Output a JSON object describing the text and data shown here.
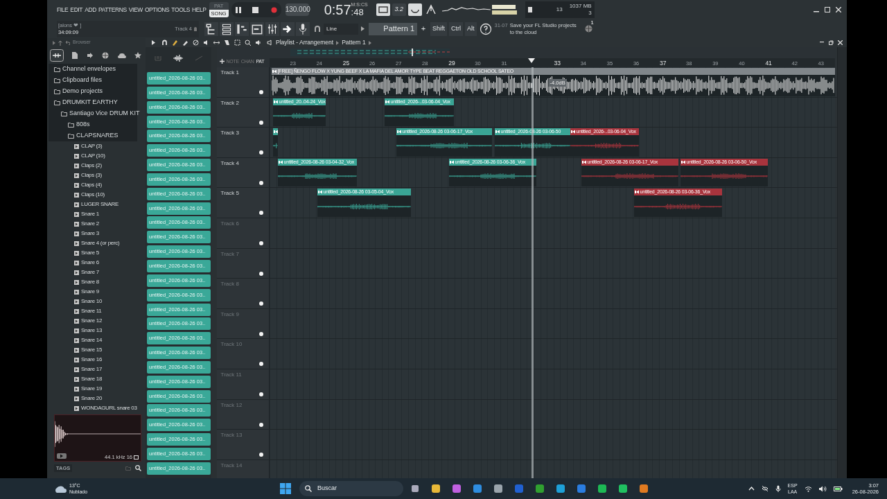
{
  "menu": [
    "FILE",
    "EDIT",
    "ADD",
    "PATTERNS",
    "VIEW",
    "OPTIONS",
    "TOOLS",
    "HELP"
  ],
  "transport": {
    "modes": [
      {
        "label": "PAT",
        "selected": false
      },
      {
        "label": "SONG",
        "selected": true
      }
    ],
    "tempo": "130.000",
    "time": "0:57",
    "time_cs": ":48",
    "time_format": "M:S:CS",
    "snap_value": "3.2"
  },
  "monitor": {
    "cpu": "13",
    "memory": "1037 MB",
    "polyphony": "3"
  },
  "hint": {
    "text": "[alons ❤ ]",
    "time": "34:09:09",
    "target": "Track 4"
  },
  "toolbar": {
    "snap": "Line",
    "pattern": "Pattern 1",
    "add": "+",
    "modifiers": [
      "Shift",
      "Ctrl",
      "Alt"
    ]
  },
  "news": {
    "date": "31-07",
    "text": "Save your FL Studio projects to the cloud",
    "badge": "1"
  },
  "browser": {
    "title": "Browser",
    "tree": [
      {
        "label": "Channel envelopes",
        "kind": "folder"
      },
      {
        "label": "Clipboard files",
        "kind": "folder"
      },
      {
        "label": "Demo projects",
        "kind": "folder"
      },
      {
        "label": "DRUMKIT EARTHY",
        "kind": "folder",
        "children": [
          {
            "label": "Santiago Vice DRUM KIT",
            "kind": "folder",
            "children": [
              {
                "label": "808s",
                "kind": "folder"
              },
              {
                "label": "CLAPSNARES",
                "kind": "folder",
                "children": [
                  {
                    "label": "CLAP (3)",
                    "kind": "sample"
                  },
                  {
                    "label": "CLAP (10)",
                    "kind": "sample"
                  },
                  {
                    "label": "Claps (2)",
                    "kind": "sample"
                  },
                  {
                    "label": "Claps (3)",
                    "kind": "sample"
                  },
                  {
                    "label": "Claps (4)",
                    "kind": "sample"
                  },
                  {
                    "label": "Claps (10)",
                    "kind": "sample"
                  },
                  {
                    "label": "LUGER SNARE",
                    "kind": "sample"
                  },
                  {
                    "label": "Snare 1",
                    "kind": "sample"
                  },
                  {
                    "label": "Snare 2",
                    "kind": "sample"
                  },
                  {
                    "label": "Snare 3",
                    "kind": "sample"
                  },
                  {
                    "label": "Snare 4 (or perc)",
                    "kind": "sample"
                  },
                  {
                    "label": "Snare 5",
                    "kind": "sample"
                  },
                  {
                    "label": "Snare 6",
                    "kind": "sample"
                  },
                  {
                    "label": "Snare 7",
                    "kind": "sample"
                  },
                  {
                    "label": "Snare 8",
                    "kind": "sample"
                  },
                  {
                    "label": "Snare 9",
                    "kind": "sample"
                  },
                  {
                    "label": "Snare 10",
                    "kind": "sample"
                  },
                  {
                    "label": "Snare 11",
                    "kind": "sample"
                  },
                  {
                    "label": "Snare 12",
                    "kind": "sample"
                  },
                  {
                    "label": "Snare 13",
                    "kind": "sample"
                  },
                  {
                    "label": "Snare 14",
                    "kind": "sample"
                  },
                  {
                    "label": "Snare 15",
                    "kind": "sample"
                  },
                  {
                    "label": "Snare 16",
                    "kind": "sample"
                  },
                  {
                    "label": "Snare 17",
                    "kind": "sample"
                  },
                  {
                    "label": "Snare 18",
                    "kind": "sample"
                  },
                  {
                    "label": "Snare 19",
                    "kind": "sample"
                  },
                  {
                    "label": "Snare 20",
                    "kind": "sample"
                  },
                  {
                    "label": "WONDAGURL snare 03",
                    "kind": "sample"
                  }
                ]
              }
            ]
          }
        ]
      }
    ],
    "preview": {
      "format": "44.1 kHz 16"
    },
    "tags": "TAGS"
  },
  "clip_list": [
    "untitled_2026-08-26 03..",
    "untitled_2026-08-26 03..",
    "untitled_2026-08-26 03..",
    "untitled_2026-08-26 03..",
    "untitled_2026-08-26 03..",
    "untitled_2026-08-26 03..",
    "untitled_2026-08-26 03..",
    "untitled_2026-08-26 03..",
    "untitled_2026-08-26 03..",
    "untitled_2026-08-26 03..",
    "untitled_2026-08-26 03..",
    "untitled_2026-08-26 03..",
    "untitled_2026-08-26 03..",
    "untitled_2026-08-26 03..",
    "untitled_2026-08-26 03..",
    "untitled_2026-08-26 03..",
    "untitled_2026-08-26 03..",
    "untitled_2026-08-26 03..",
    "untitled_2026-08-26 03..",
    "untitled_2026-08-26 03..",
    "untitled_2026-08-26 03..",
    "untitled_2026-08-26 03..",
    "untitled_2026-08-26 03..",
    "untitled_2026-08-26 03..",
    "untitled_2026-08-26 03..",
    "untitled_2026-08-26 03..",
    "untitled_2026-08-26 03..",
    "untitled_2026-08-26 03.."
  ],
  "playlist": {
    "title": "Playlist - Arrangement",
    "pattern": "Pattern 1",
    "modes": [
      "NOTE",
      "CHAN",
      "PAT"
    ],
    "ruler": [
      "23",
      "24",
      "25",
      "26",
      "27",
      "28",
      "29",
      "30",
      "31",
      "33",
      "34",
      "35",
      "36",
      "37",
      "38",
      "39",
      "40",
      "41",
      "42",
      "43"
    ],
    "tracks": [
      {
        "name": "Track 1",
        "clips": [
          {
            "label": "[FREE] ÑENGO FLOW X YUNG BEEF X LA MAFIA DEL AMOR TYPE BEAT REGGAETON OLD SCHOOL SATEO",
            "color": "#80868a",
            "gain": "-4.0dB"
          }
        ]
      },
      {
        "name": "Track 2",
        "clips": [
          {
            "label": "untitled_20..04-24_Vox",
            "color": "#3aa595"
          },
          {
            "label": "untitled_2026-..03-06-04_Vox",
            "color": "#3aa595"
          }
        ]
      },
      {
        "name": "Track 3",
        "clips": [
          {
            "color": "#3aa595"
          },
          {
            "label": "untitled_2026-08-26 03-06-17_Vox",
            "color": "#3aa595"
          },
          {
            "label": "untitled_2026-08-26 03-06-50",
            "color": "#3aa595"
          },
          {
            "label": "untitled_2026-..03-06-04_Vox",
            "color": "#a8343d"
          }
        ]
      },
      {
        "name": "Track 4",
        "clips": [
          {
            "label": "untitled_2026-08-26 03-04-32_Vox",
            "color": "#3aa595"
          },
          {
            "label": "untitled_2026-08-26 03-06-36_Vox",
            "color": "#3aa595"
          },
          {
            "label": "untitled_2026-08-26 03-06-17_Vox",
            "color": "#a8343d"
          },
          {
            "label": "untitled_2026-08-26 03-06-50_Vox",
            "color": "#a8343d"
          }
        ]
      },
      {
        "name": "Track 5",
        "clips": [
          {
            "label": "untitled_2026-08-26 03-05-04_Vox",
            "color": "#3aa595"
          },
          {
            "label": "untitled_2026-08-26 03-06-36_Vox",
            "color": "#a8343d"
          }
        ]
      },
      {
        "name": "Track 6"
      },
      {
        "name": "Track 7"
      },
      {
        "name": "Track 8"
      },
      {
        "name": "Track 9"
      },
      {
        "name": "Track 10"
      },
      {
        "name": "Track 11"
      },
      {
        "name": "Track 12"
      },
      {
        "name": "Track 13"
      },
      {
        "name": "Track 14"
      }
    ]
  },
  "taskbar": {
    "temperature": "13°C",
    "weather": "Nublado",
    "search": "Buscar",
    "language": "ESP",
    "layout": "LAA",
    "time": "3:07",
    "date": "26-08-2026"
  }
}
